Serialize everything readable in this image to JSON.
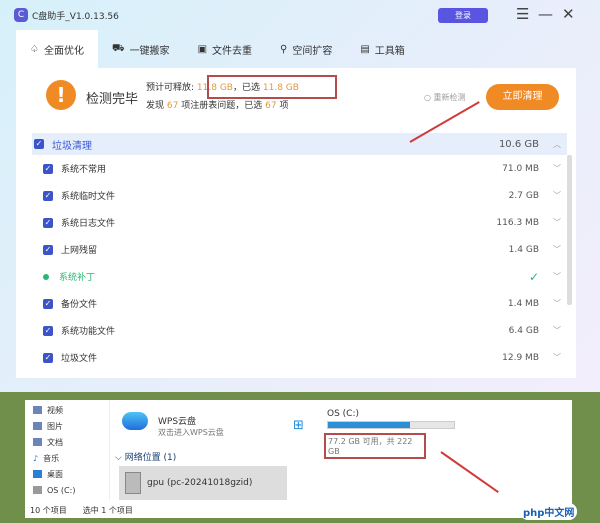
{
  "app": {
    "title": "C盘助手_V1.0.13.56",
    "login": "登录"
  },
  "tabs": [
    {
      "label": "全面优化",
      "icon": "bell-icon"
    },
    {
      "label": "一键搬家",
      "icon": "truck-icon"
    },
    {
      "label": "文件去重",
      "icon": "file-icon"
    },
    {
      "label": "空间扩容",
      "icon": "expand-icon"
    },
    {
      "label": "工具箱",
      "icon": "toolbox-icon"
    }
  ],
  "summary": {
    "status": "检测完毕",
    "release_label": "预计可释放:",
    "release": "11.8 GB",
    "selected_label": "，已选",
    "selected": "11.8 GB",
    "found_label": "发现",
    "found": "67",
    "issues_label": "项注册表问题，已选",
    "issues_selected": "67",
    "unit": "项",
    "recheck": "重新检测",
    "clean": "立即清理"
  },
  "list": {
    "header": {
      "label": "垃圾清理",
      "size": "10.6 GB"
    },
    "rows": [
      {
        "label": "系统不常用",
        "size": "71.0 MB"
      },
      {
        "label": "系统临时文件",
        "size": "2.7 GB"
      },
      {
        "label": "系统日志文件",
        "size": "116.3 MB"
      },
      {
        "label": "上网残留",
        "size": "1.4 GB"
      },
      {
        "label": "系统补丁",
        "size": "✓"
      },
      {
        "label": "备份文件",
        "size": "1.4 MB"
      },
      {
        "label": "系统功能文件",
        "size": "6.4 GB"
      },
      {
        "label": "垃圾文件",
        "size": "12.9 MB"
      }
    ]
  },
  "explorer": {
    "nav": [
      "视频",
      "图片",
      "文档",
      "音乐",
      "桌面",
      "OS (C:)"
    ],
    "wps_title": "WPS云盘",
    "wps_sub": "双击进入WPS云盘",
    "drive": "OS (C:)",
    "drive_free": "77.2 GB 可用，共 222 GB",
    "drive_used_fraction": 0.65,
    "network": "网络位置 (1)",
    "gpu": "gpu (pc-20241018gzid)",
    "count": "10 个项目",
    "selected": "选中 1 个项目"
  },
  "watermark": "php中文网"
}
